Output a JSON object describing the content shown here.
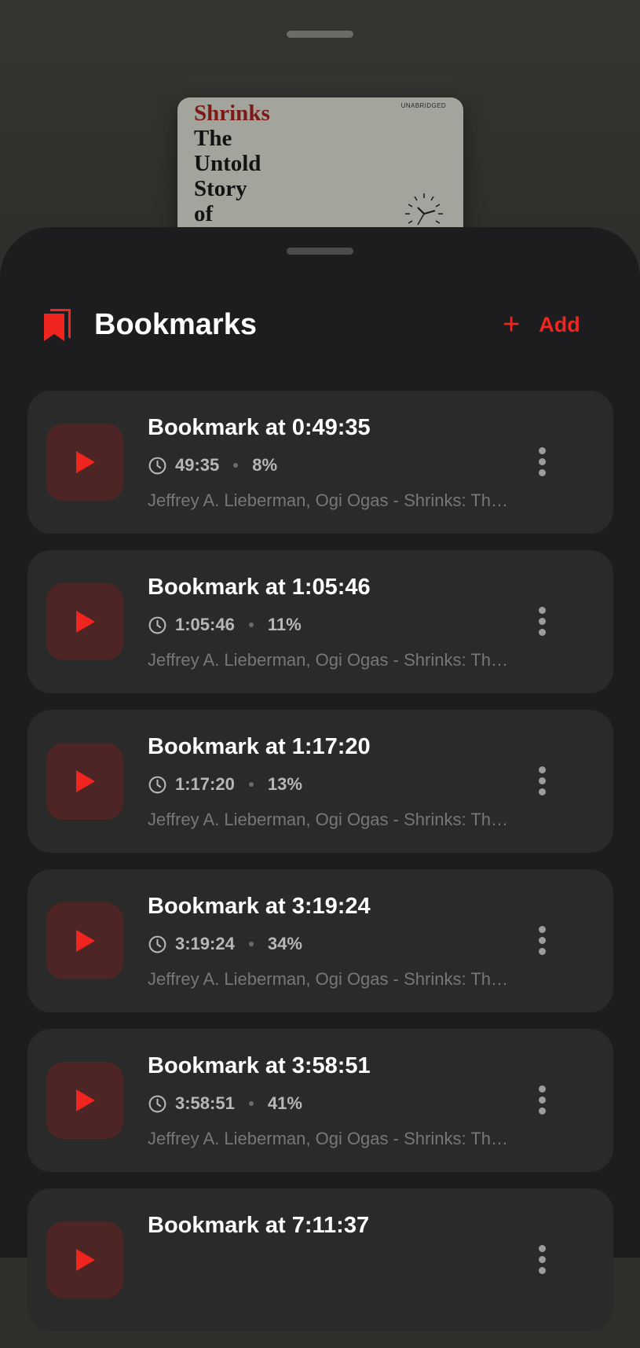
{
  "cover": {
    "title_lines": [
      "Shrinks",
      "The",
      "Untold",
      "Story",
      "of"
    ],
    "badge": "UNABRIDGED"
  },
  "header": {
    "title": "Bookmarks",
    "add_label": "Add",
    "accent_color": "#f0251f"
  },
  "bookmarks": [
    {
      "title": "Bookmark at 0:49:35",
      "time": "49:35",
      "percent": "8%",
      "author": "Jeffrey A. Lieberman, Ogi Ogas - Shrinks: The Untold Story of Psychiatry"
    },
    {
      "title": "Bookmark at 1:05:46",
      "time": "1:05:46",
      "percent": "11%",
      "author": "Jeffrey A. Lieberman, Ogi Ogas - Shrinks: The Untold Story of Psychiatry"
    },
    {
      "title": "Bookmark at 1:17:20",
      "time": "1:17:20",
      "percent": "13%",
      "author": "Jeffrey A. Lieberman, Ogi Ogas - Shrinks: The Untold Story of Psychiatry"
    },
    {
      "title": "Bookmark at 3:19:24",
      "time": "3:19:24",
      "percent": "34%",
      "author": "Jeffrey A. Lieberman, Ogi Ogas - Shrinks: The Untold Story of Psychiatry"
    },
    {
      "title": "Bookmark at 3:58:51",
      "time": "3:58:51",
      "percent": "41%",
      "author": "Jeffrey A. Lieberman, Ogi Ogas - Shrinks: The Untold Story of Psychiatry"
    },
    {
      "title": "Bookmark at 7:11:37",
      "time": "",
      "percent": "",
      "author": ""
    }
  ]
}
